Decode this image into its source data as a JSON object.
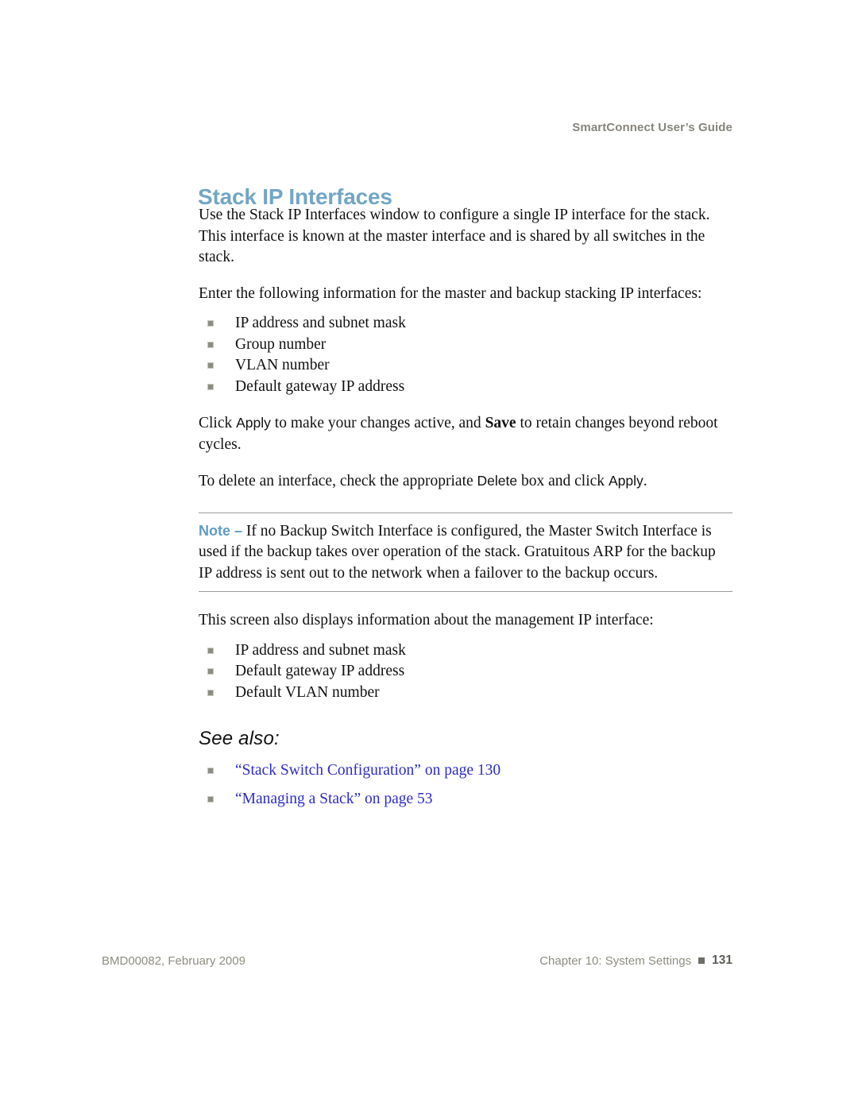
{
  "header": {
    "running_title": "SmartConnect User’s Guide"
  },
  "title": "Stack IP Interfaces",
  "intro": {
    "paragraph1": "Use the Stack IP Interfaces window to configure a single IP interface for the stack. This interface is known at the master interface and is shared by all switches in the stack.",
    "paragraph2": "Enter the following information for the master and backup stacking IP interfaces:"
  },
  "config_list": [
    "IP address and subnet mask",
    "Group number",
    "VLAN number",
    "Default gateway IP address"
  ],
  "apply_paragraph": {
    "part1": "Click ",
    "apply_label": "Apply",
    "part2": " to make your changes active, and ",
    "save_label": "Save",
    "part3": " to retain changes beyond reboot cycles."
  },
  "delete_paragraph": {
    "part1": "To delete an interface, check the appropriate ",
    "delete_label": "Delete",
    "part2": " box and click ",
    "apply_label": "Apply",
    "part3": "."
  },
  "note": {
    "label": "Note –",
    "text": " If no Backup Switch Interface is configured, the Master Switch Interface is used if the backup takes over operation of the stack. Gratuitous ARP for the backup IP address is sent out to the network when a failover to the backup occurs."
  },
  "management": {
    "lead_in": "This screen also displays information about the management IP interface:",
    "items": [
      "IP address and subnet mask",
      "Default gateway IP address",
      "Default VLAN number"
    ]
  },
  "see_also": {
    "heading": "See also:",
    "links": [
      "“Stack Switch Configuration” on page 130",
      "“Managing a Stack” on page 53"
    ]
  },
  "footer": {
    "doc_id": "BMD00082, February 2009",
    "chapter": "Chapter 10: System Settings",
    "page_number": "131"
  },
  "colors": {
    "title_blue": "#72a6c4",
    "note_blue": "#5e9cc2",
    "link_blue": "#2d2dc6",
    "bullet_gray": "#8d8d84",
    "footer_gray": "#8f8d81"
  }
}
